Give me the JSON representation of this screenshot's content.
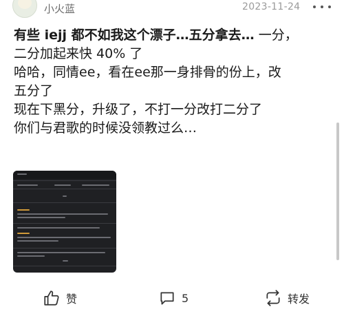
{
  "post": {
    "username": "小火蓝",
    "date": "2023-11-24",
    "lines": [
      {
        "text": "有些 iejj 都不如我这个漂子…五分拿去… 一分，",
        "bold_prefix": "有些 iejj 都不如我这个漂子…五分拿去…",
        "rest": " 一分，"
      },
      {
        "text": "二分加起来快 40% 了"
      },
      {
        "text": "哈哈，同情ee，看在ee那一身排骨的份上，改"
      },
      {
        "text": "五分了"
      },
      {
        "text": "现在下黑分，升级了，不打一分改打二分了"
      },
      {
        "text": "你们与君歌的时候没领教过么…"
      }
    ]
  },
  "actions": {
    "like_label": "赞",
    "comment_count": "5",
    "share_label": "转发"
  },
  "icons": {
    "more": "more-horizontal-icon",
    "like": "thumbs-up-icon",
    "comment": "comment-bubble-icon",
    "share": "repost-icon"
  }
}
